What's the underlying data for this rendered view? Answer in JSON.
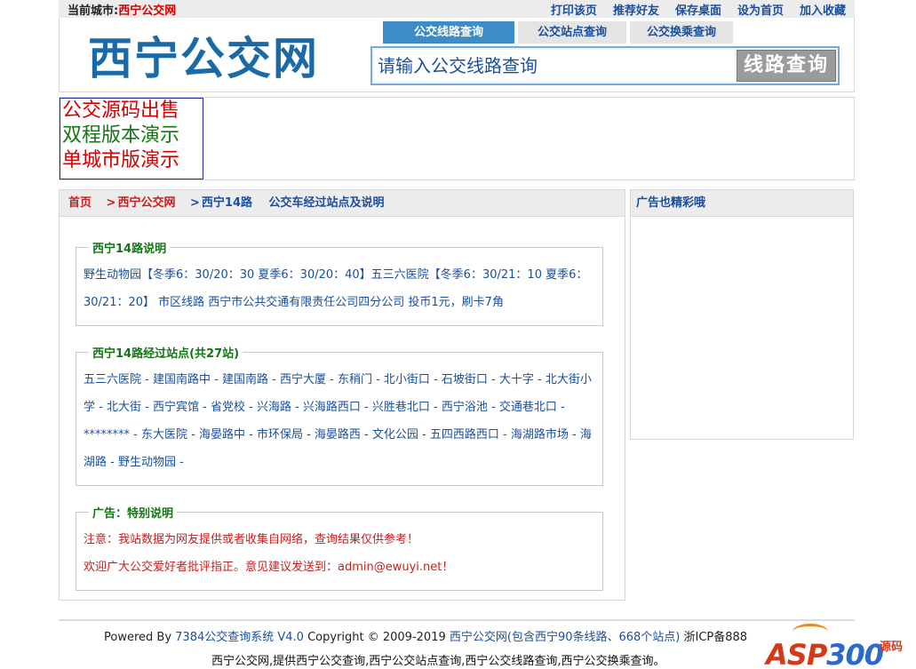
{
  "topbar": {
    "city_label": "当前城市:",
    "city_name": "西宁公交网",
    "links": [
      "打印该页",
      "推荐好友",
      "保存桌面",
      "设为首页",
      "加入收藏"
    ]
  },
  "header": {
    "logo": "西宁公交网",
    "tabs": [
      "公交线路查询",
      "公交站点查询",
      "公交换乘查询"
    ],
    "search_placeholder": "请输入公交线路查询",
    "search_button": "线路查询"
  },
  "promo": {
    "lines": [
      "公交源码出售",
      "双程版本演示",
      "单城市版演示"
    ]
  },
  "breadcrumb": {
    "home": "首页",
    "site": "西宁公交网",
    "route": "西宁14路",
    "title": "公交车经过站点及说明"
  },
  "route_desc": {
    "legend": "西宁14路说明",
    "text": "野生动物园【冬季6：30/20：30 夏季6：30/20：40】五三六医院【冬季6：30/21：10 夏季6：30/21：20】 市区线路 西宁市公共交通有限责任公司四分公司 投币1元，刷卡7角"
  },
  "route_stops": {
    "legend": "西宁14路经过站点(共27站)",
    "stops": [
      "五三六医院",
      "建国南路中",
      "建国南路",
      "西宁大厦",
      "东稍门",
      "北小街口",
      "石坡街口",
      "大十字",
      "北大街小学",
      "北大街",
      "西宁宾馆",
      "省党校",
      "兴海路",
      "兴海路西口",
      "兴胜巷北口",
      "西宁浴池",
      "交通巷北口",
      "********",
      "东大医院",
      "海晏路中",
      "市环保局",
      "海晏路西",
      "文化公园",
      "五四西路西口",
      "海湖路市场",
      "海湖路",
      "野生动物园"
    ],
    "separator": "-"
  },
  "notice": {
    "legend": "广告：特别说明",
    "line1": "注意：我站数据为网友提供或者收集自网络，查询结果仅供参考！",
    "line2": "欢迎广大公交爱好者批评指正。意见建议发送到：admin@ewuyi.net！"
  },
  "sidebar": {
    "title": "广告也精彩哦"
  },
  "footer": {
    "powered_prefix": "Powered By ",
    "powered_system": "7384公交查询系统  V4.0",
    "copyright": " Copyright © 2009-2019 ",
    "site_info": "西宁公交网(包含西宁90条线路、668个站点)",
    "icp": " 浙ICP备888",
    "line2": "西宁公交网,提供西宁公交查询,西宁公交站点查询,西宁公交线路查询,西宁公交换乘查询。"
  },
  "watermark": {
    "brand_a": "ASP",
    "brand_b": "300",
    "tag": "源码"
  }
}
